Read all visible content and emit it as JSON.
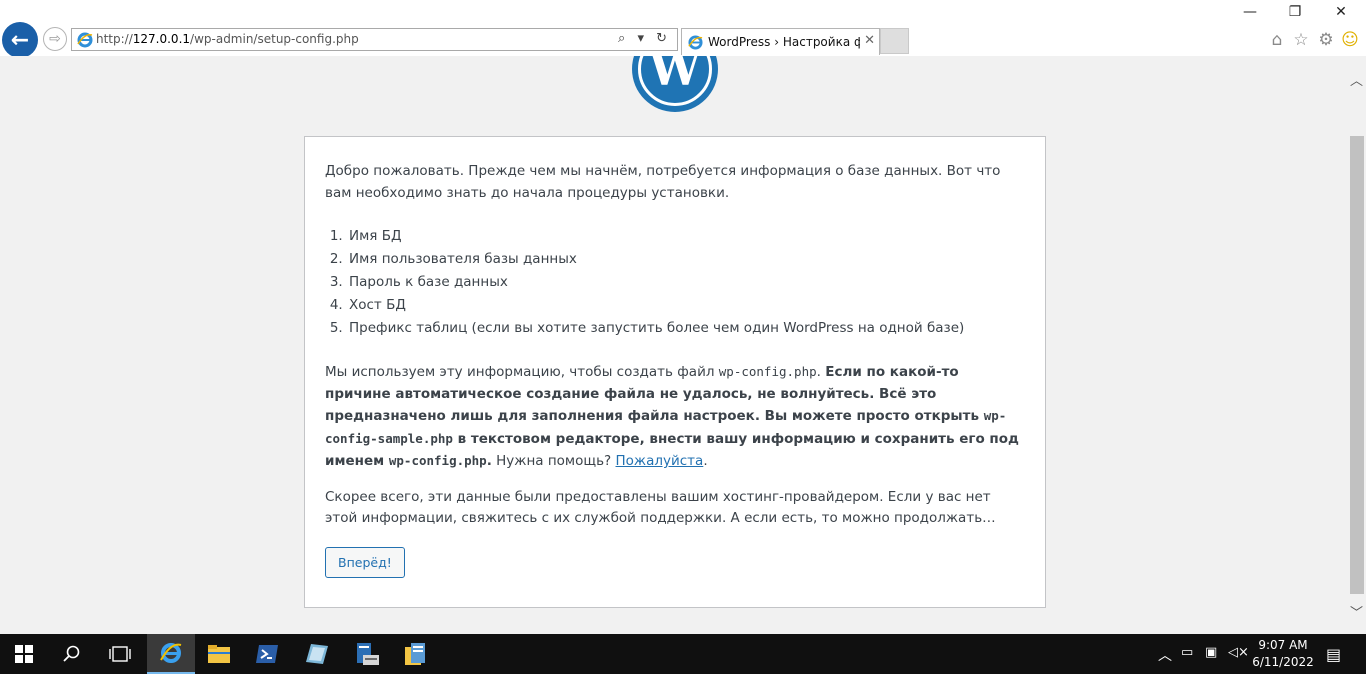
{
  "browser": {
    "address_prefix": "http://",
    "address_host": "127.0.0.1",
    "address_path": "/wp-admin/setup-config.php",
    "tab_title": "WordPress › Настройка фа...",
    "tools_glyphs": "⌕ ▾ ↻"
  },
  "page": {
    "intro": "Добро пожаловать. Прежде чем мы начнём, потребуется информация о базе данных. Вот что вам необходимо знать до начала процедуры установки.",
    "items": [
      "Имя БД",
      "Имя пользователя базы данных",
      "Пароль к базе данных",
      "Хост БД",
      "Префикс таблиц (если вы хотите запустить более чем один WordPress на одной базе)"
    ],
    "info_1": "Мы используем эту информацию, чтобы создать файл ",
    "info_file": "wp-config.php",
    "info_2": ". ",
    "info_bold_1": "Если по какой-то причине автоматическое создание файла не удалось, не волнуйтесь. Всё это предназначено лишь для заполнения файла настроек. Вы можете просто открыть ",
    "info_sample": "wp-config-sample.php",
    "info_bold_2": " в текстовом редакторе, внести вашу информацию и сохранить его под именем ",
    "info_file_2": "wp-config.php",
    "info_bold_3": ".",
    "info_3": " Нужна помощь? ",
    "help_link": "Пожалуйста",
    "info_4": ".",
    "hosting": "Скорее всего, эти данные были предоставлены вашим хостинг-провайдером. Если у вас нет этой информации, свяжитесь с их службой поддержки. А если есть, то можно продолжать…",
    "button": "Вперёд!"
  },
  "taskbar": {
    "time": "9:07 AM",
    "date": "6/11/2022"
  },
  "colors": {
    "accent": "#2271b1",
    "logo": "#1f74b4",
    "taskbar": "#101010"
  }
}
